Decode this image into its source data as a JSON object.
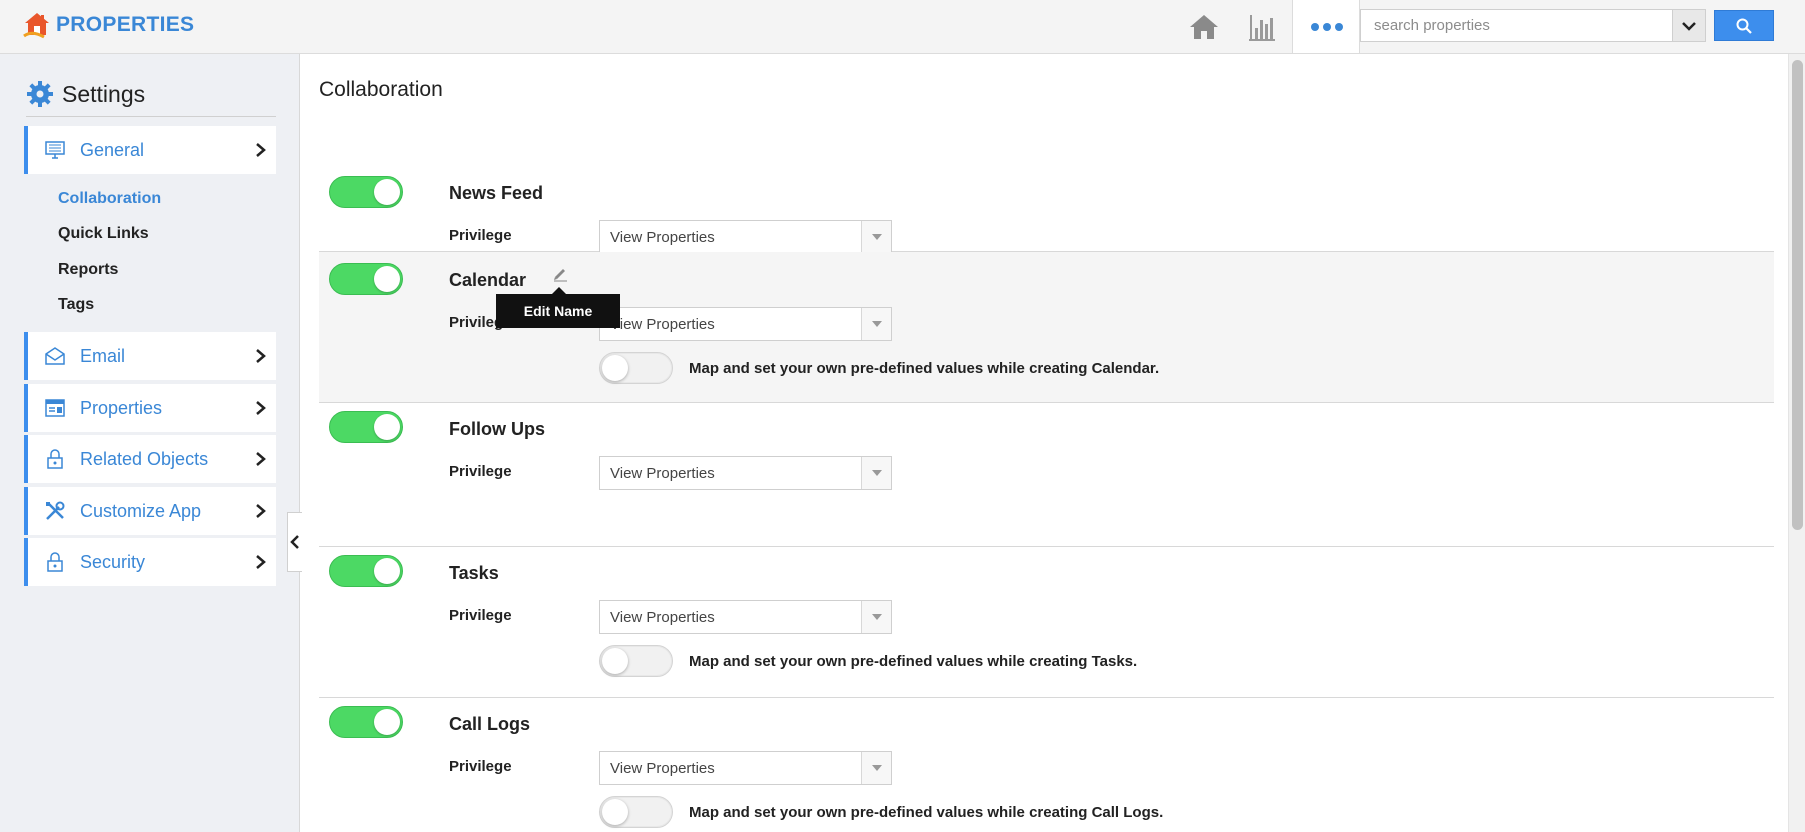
{
  "app": {
    "name": "PROPERTIES",
    "accent": "#3a87d6"
  },
  "topbar": {
    "icons": [
      "home-icon",
      "bar-chart-icon",
      "more-dots-icon"
    ],
    "search_placeholder": "search properties"
  },
  "sidebar": {
    "title": "Settings",
    "items": [
      {
        "label": "General",
        "icon": "monitor-icon"
      },
      {
        "label": "Email",
        "icon": "envelope-icon"
      },
      {
        "label": "Properties",
        "icon": "properties-icon"
      },
      {
        "label": "Related Objects",
        "icon": "lock-icon"
      },
      {
        "label": "Customize App",
        "icon": "tools-icon"
      },
      {
        "label": "Security",
        "icon": "lock-icon"
      }
    ],
    "general_subitems": [
      "Collaboration",
      "Quick Links",
      "Reports",
      "Tags"
    ],
    "active_subitem": "Collaboration"
  },
  "main": {
    "title": "Collaboration",
    "privilege_label": "Privilege",
    "tooltip": "Edit Name",
    "features": [
      {
        "name": "News Feed",
        "enabled": true,
        "privilege": "View Properties"
      },
      {
        "name": "Calendar",
        "enabled": true,
        "privilege": "View Properties",
        "map_text": "Map and set your own pre-defined values while creating Calendar.",
        "map_enabled": false
      },
      {
        "name": "Follow Ups",
        "enabled": true,
        "privilege": "View Properties"
      },
      {
        "name": "Tasks",
        "enabled": true,
        "privilege": "View Properties",
        "map_text": "Map and set your own pre-defined values while creating Tasks.",
        "map_enabled": false
      },
      {
        "name": "Call Logs",
        "enabled": true,
        "privilege": "View Properties",
        "map_text": "Map and set your own pre-defined values while creating Call Logs.",
        "map_enabled": false
      }
    ]
  }
}
